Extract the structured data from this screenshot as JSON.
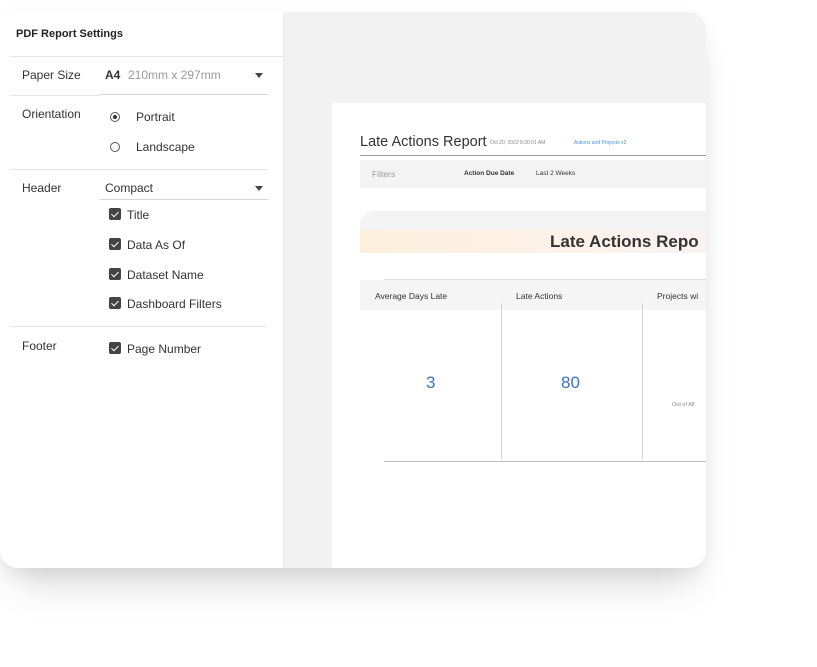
{
  "panel": {
    "title": "PDF Report Settings",
    "paper_size": {
      "label": "Paper Size",
      "value": "A4",
      "detail": "210mm x 297mm"
    },
    "orientation": {
      "label": "Orientation",
      "options": [
        {
          "label": "Portrait",
          "selected": true
        },
        {
          "label": "Landscape",
          "selected": false
        }
      ]
    },
    "header": {
      "label": "Header",
      "value": "Compact",
      "checks": [
        "Title",
        "Data As Of",
        "Dataset Name",
        "Dashboard Filters"
      ]
    },
    "footer": {
      "label": "Footer",
      "checks": [
        "Page Number"
      ]
    }
  },
  "preview": {
    "report_title": "Late Actions Report",
    "timestamp": "Oct 20, 2022 8:30:01 AM",
    "dataset_link": "Actions and Projects v2",
    "filters_label": "Filters",
    "filter_key": "Action Due Date",
    "filter_value": "Last 2 Weeks",
    "banner_title": "Late Actions Repo",
    "kpis": [
      {
        "header": "Average Days Late",
        "value": "3"
      },
      {
        "header": "Late Actions",
        "value": "80"
      },
      {
        "header": "Projects wi",
        "value": "",
        "sub": "Out of All"
      }
    ]
  }
}
